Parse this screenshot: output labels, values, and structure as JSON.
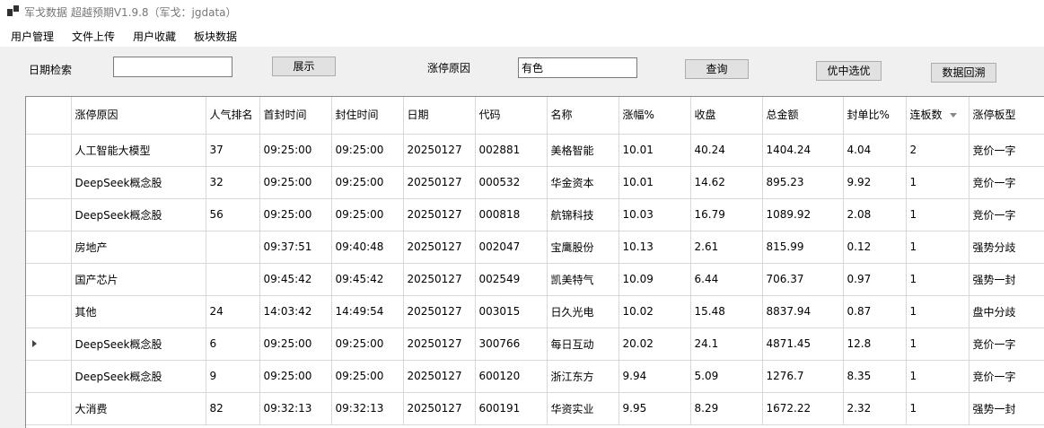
{
  "window": {
    "title": "军戈数据 超越预期V1.9.8（军戈：jgdata）"
  },
  "menu": [
    "用户管理",
    "文件上传",
    "用户收藏",
    "板块数据"
  ],
  "toolbar": {
    "date_search_label": "日期检索",
    "date_search_value": "",
    "show_button": "展示",
    "reason_label": "涨停原因",
    "reason_value": "有色",
    "query_button": "查询",
    "select_best_button": "优中选优",
    "backtrack_button": "数据回溯"
  },
  "table": {
    "columns": [
      "涨停原因",
      "人气排名",
      "首封时间",
      "封住时间",
      "日期",
      "代码",
      "名称",
      "涨幅%",
      "收盘",
      "总金额",
      "封单比%",
      "连板数",
      "涨停板型"
    ],
    "selected_row": 6,
    "rows": [
      [
        "人工智能大模型",
        "37",
        "09:25:00",
        "09:25:00",
        "20250127",
        "002881",
        "美格智能",
        "10.01",
        "40.24",
        "1404.24",
        "4.04",
        "2",
        "竞价一字"
      ],
      [
        "DeepSeek概念股",
        "32",
        "09:25:00",
        "09:25:00",
        "20250127",
        "000532",
        "华金资本",
        "10.01",
        "14.62",
        "895.23",
        "9.92",
        "1",
        "竞价一字"
      ],
      [
        "DeepSeek概念股",
        "56",
        "09:25:00",
        "09:25:00",
        "20250127",
        "000818",
        "航锦科技",
        "10.03",
        "16.79",
        "1089.92",
        "2.08",
        "1",
        "竞价一字"
      ],
      [
        "房地产",
        "",
        "09:37:51",
        "09:40:48",
        "20250127",
        "002047",
        "宝鹰股份",
        "10.13",
        "2.61",
        "815.99",
        "0.12",
        "1",
        "强势分歧"
      ],
      [
        "国产芯片",
        "",
        "09:45:42",
        "09:45:42",
        "20250127",
        "002549",
        "凯美特气",
        "10.09",
        "6.44",
        "706.37",
        "0.97",
        "1",
        "强势一封"
      ],
      [
        "其他",
        "24",
        "14:03:42",
        "14:49:54",
        "20250127",
        "003015",
        "日久光电",
        "10.02",
        "15.48",
        "8837.94",
        "0.87",
        "1",
        "盘中分歧"
      ],
      [
        "DeepSeek概念股",
        "6",
        "09:25:00",
        "09:25:00",
        "20250127",
        "300766",
        "每日互动",
        "20.02",
        "24.1",
        "4871.45",
        "12.8",
        "1",
        "竞价一字"
      ],
      [
        "DeepSeek概念股",
        "9",
        "09:25:00",
        "09:25:00",
        "20250127",
        "600120",
        "浙江东方",
        "9.94",
        "5.09",
        "1276.7",
        "8.35",
        "1",
        "竞价一字"
      ],
      [
        "大消费",
        "82",
        "09:32:13",
        "09:32:13",
        "20250127",
        "600191",
        "华资实业",
        "9.95",
        "8.29",
        "1672.22",
        "2.32",
        "1",
        "强势一封"
      ]
    ]
  }
}
